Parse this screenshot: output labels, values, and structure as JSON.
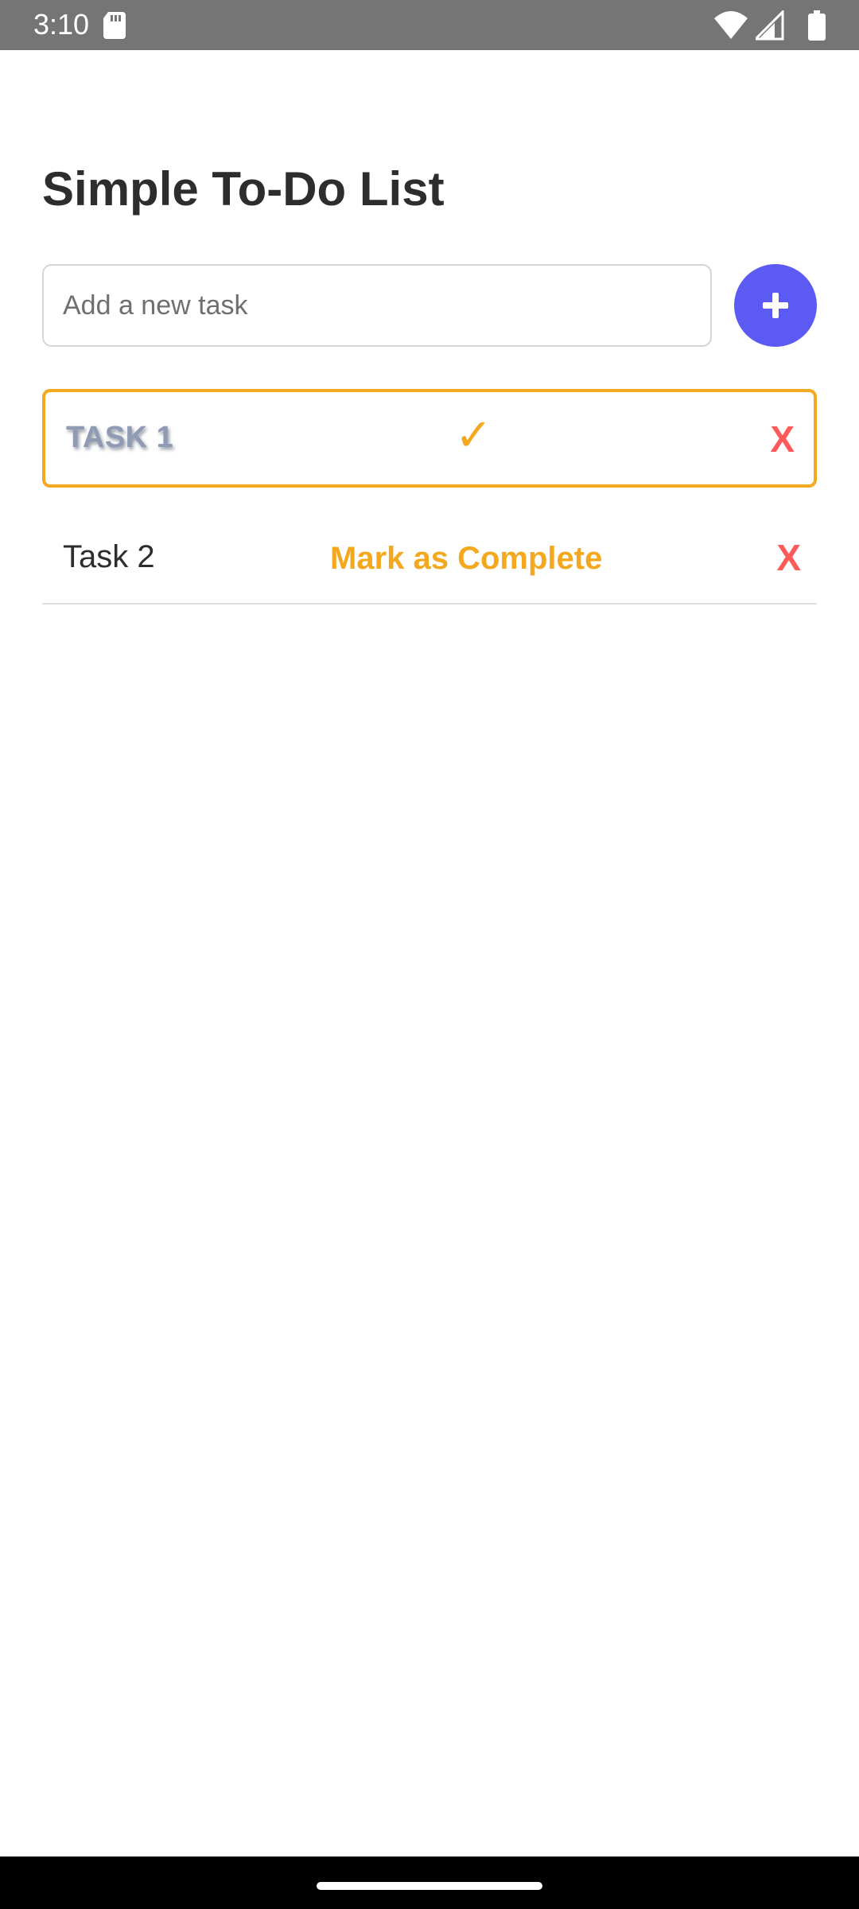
{
  "status_bar": {
    "time": "3:10",
    "icons": [
      "sd-card-icon",
      "wifi-icon",
      "signal-icon",
      "battery-icon"
    ]
  },
  "app": {
    "title": "Simple To-Do List"
  },
  "new_task": {
    "placeholder": "Add a new task",
    "value": "",
    "add_label": "+"
  },
  "tasks": [
    {
      "name": "TASK 1",
      "completed": true,
      "toggle_label": "✓",
      "delete_label": "X"
    },
    {
      "name": "Task 2",
      "completed": false,
      "toggle_label": "Mark as Complete",
      "delete_label": "X"
    }
  ],
  "colors": {
    "accent": "#5b5bf4",
    "complete": "#f4a81d",
    "delete": "#ff5a5a",
    "status_bar": "#757575"
  }
}
